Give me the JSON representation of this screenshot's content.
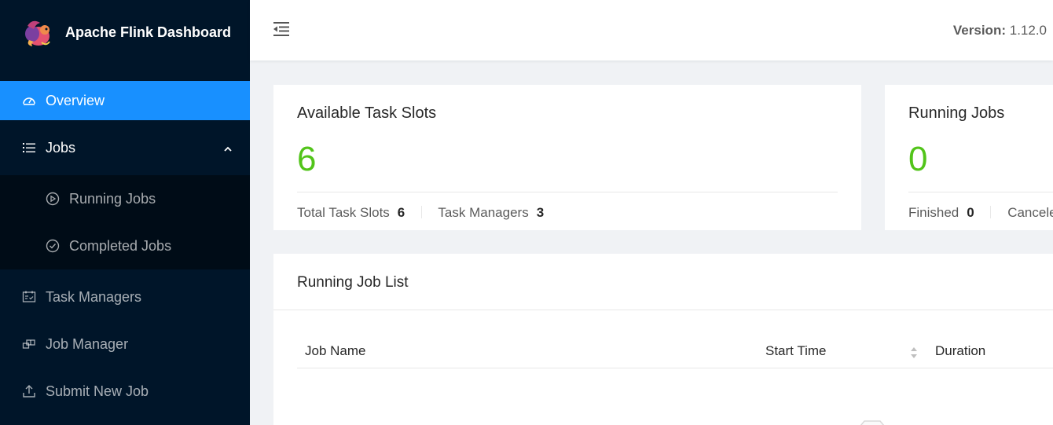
{
  "app": {
    "title": "Apache Flink Dashboard",
    "logo_icon": "flink-squirrel-logo"
  },
  "sidebar": {
    "items": [
      {
        "label": "Overview",
        "icon": "dashboard-icon",
        "active": true
      },
      {
        "label": "Jobs",
        "icon": "unordered-list-icon",
        "expanded": true,
        "children": [
          {
            "label": "Running Jobs",
            "icon": "play-circle-icon"
          },
          {
            "label": "Completed Jobs",
            "icon": "check-circle-icon"
          }
        ]
      },
      {
        "label": "Task Managers",
        "icon": "schedule-icon"
      },
      {
        "label": "Job Manager",
        "icon": "build-icon"
      },
      {
        "label": "Submit New Job",
        "icon": "upload-icon"
      }
    ]
  },
  "header": {
    "version_label": "Version:",
    "version_value": "1.12.0"
  },
  "cards": {
    "task_slots": {
      "title": "Available Task Slots",
      "value": "6",
      "total_label": "Total Task Slots",
      "total_value": "6",
      "tm_label": "Task Managers",
      "tm_value": "3"
    },
    "running_jobs": {
      "title": "Running Jobs",
      "value": "0",
      "finished_label": "Finished",
      "finished_value": "0",
      "canceled_label": "Canceled"
    }
  },
  "job_list": {
    "title": "Running Job List",
    "columns": [
      "Job Name",
      "Start Time",
      "Duration"
    ]
  },
  "colors": {
    "sidebar_bg": "#001529",
    "submenu_bg": "#000c17",
    "active": "#1890ff",
    "success": "#52c41a"
  }
}
